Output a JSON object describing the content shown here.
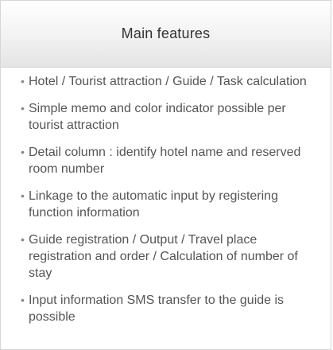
{
  "header": {
    "title": "Main features"
  },
  "features": [
    "Hotel / Tourist attraction / Guide / Task calculation",
    "Simple memo and color indicator possible per tourist attraction",
    "Detail column : identify hotel name and reserved room number",
    "Linkage to the automatic input by registering function information",
    "Guide registration / Output / Travel place registration and order / Calculation of number of stay",
    "Input information SMS transfer to the guide is possible"
  ],
  "bullet_glyph": "•"
}
